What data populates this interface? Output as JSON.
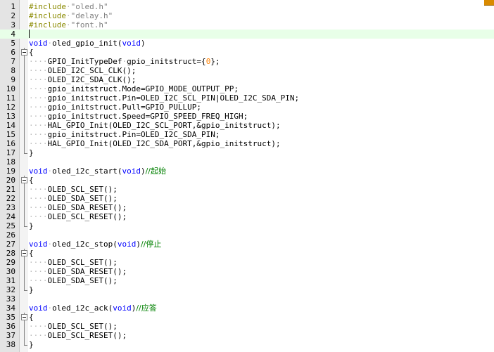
{
  "editor": {
    "colors": {
      "keyword": "#0000ff",
      "preprocessor": "#8a8a00",
      "string": "#808080",
      "number": "#ff8000",
      "comment": "#008000",
      "current_line": "#e8ffe8"
    },
    "lines": [
      {
        "n": "1",
        "fold": "",
        "tokens": [
          {
            "t": "pp",
            "v": "#include"
          },
          {
            "t": "indent",
            "v": "·"
          },
          {
            "t": "str",
            "v": "\"oled.h\""
          }
        ]
      },
      {
        "n": "2",
        "fold": "",
        "tokens": [
          {
            "t": "pp",
            "v": "#include"
          },
          {
            "t": "indent",
            "v": "·"
          },
          {
            "t": "str",
            "v": "\"delay.h\""
          }
        ]
      },
      {
        "n": "3",
        "fold": "",
        "tokens": [
          {
            "t": "pp",
            "v": "#include"
          },
          {
            "t": "indent",
            "v": "·"
          },
          {
            "t": "str",
            "v": "\"font.h\""
          }
        ]
      },
      {
        "n": "4",
        "fold": "",
        "current": true,
        "tokens": []
      },
      {
        "n": "5",
        "fold": "",
        "tokens": [
          {
            "t": "kw",
            "v": "void"
          },
          {
            "t": "indent",
            "v": "·"
          },
          {
            "t": "plain",
            "v": "oled_gpio_init("
          },
          {
            "t": "kw",
            "v": "void"
          },
          {
            "t": "plain",
            "v": ")"
          }
        ]
      },
      {
        "n": "6",
        "fold": "open",
        "tokens": [
          {
            "t": "plain",
            "v": "{"
          }
        ]
      },
      {
        "n": "7",
        "fold": "line",
        "tokens": [
          {
            "t": "indent",
            "v": "····"
          },
          {
            "t": "plain",
            "v": "GPIO_InitTypeDef"
          },
          {
            "t": "indent",
            "v": "·"
          },
          {
            "t": "plain",
            "v": "gpio_initstruct={"
          },
          {
            "t": "num",
            "v": "0"
          },
          {
            "t": "plain",
            "v": "};"
          }
        ]
      },
      {
        "n": "8",
        "fold": "line",
        "tokens": [
          {
            "t": "indent",
            "v": "····"
          },
          {
            "t": "plain",
            "v": "OLED_I2C_SCL_CLK();"
          }
        ]
      },
      {
        "n": "9",
        "fold": "line",
        "tokens": [
          {
            "t": "indent",
            "v": "····"
          },
          {
            "t": "plain",
            "v": "OLED_I2C_SDA_CLK();"
          }
        ]
      },
      {
        "n": "10",
        "fold": "line",
        "tokens": [
          {
            "t": "indent",
            "v": "····"
          },
          {
            "t": "plain",
            "v": "gpio_initstruct.Mode=GPIO_MODE_OUTPUT_PP;"
          }
        ]
      },
      {
        "n": "11",
        "fold": "line",
        "tokens": [
          {
            "t": "indent",
            "v": "····"
          },
          {
            "t": "plain",
            "v": "gpio_initstruct.Pin=OLED_I2C_SCL_PIN|OLED_I2C_SDA_PIN;"
          }
        ]
      },
      {
        "n": "12",
        "fold": "line",
        "tokens": [
          {
            "t": "indent",
            "v": "····"
          },
          {
            "t": "plain",
            "v": "gpio_initstruct.Pull=GPIO_PULLUP;"
          }
        ]
      },
      {
        "n": "13",
        "fold": "line",
        "tokens": [
          {
            "t": "indent",
            "v": "····"
          },
          {
            "t": "plain",
            "v": "gpio_initstruct.Speed=GPIO_SPEED_FREQ_HIGH;"
          }
        ]
      },
      {
        "n": "14",
        "fold": "line",
        "tokens": [
          {
            "t": "indent",
            "v": "····"
          },
          {
            "t": "plain",
            "v": "HAL_GPIO_Init(OLED_I2C_SCL_PORT,&gpio_initstruct);"
          }
        ]
      },
      {
        "n": "15",
        "fold": "line",
        "tokens": [
          {
            "t": "indent",
            "v": "····"
          },
          {
            "t": "plain",
            "v": "gpio_initstruct.Pin=OLED_I2C_SDA_PIN;"
          }
        ]
      },
      {
        "n": "16",
        "fold": "line",
        "tokens": [
          {
            "t": "indent",
            "v": "····"
          },
          {
            "t": "plain",
            "v": "HAL_GPIO_Init(OLED_I2C_SDA_PORT,&gpio_initstruct);"
          }
        ]
      },
      {
        "n": "17",
        "fold": "end",
        "tokens": [
          {
            "t": "plain",
            "v": "}"
          }
        ]
      },
      {
        "n": "18",
        "fold": "",
        "tokens": []
      },
      {
        "n": "19",
        "fold": "",
        "tokens": [
          {
            "t": "kw",
            "v": "void"
          },
          {
            "t": "indent",
            "v": "·"
          },
          {
            "t": "plain",
            "v": "oled_i2c_start("
          },
          {
            "t": "kw",
            "v": "void"
          },
          {
            "t": "plain",
            "v": ")"
          },
          {
            "t": "cm",
            "v": "//起始"
          }
        ]
      },
      {
        "n": "20",
        "fold": "open",
        "tokens": [
          {
            "t": "plain",
            "v": "{"
          }
        ]
      },
      {
        "n": "21",
        "fold": "line",
        "tokens": [
          {
            "t": "indent",
            "v": "····"
          },
          {
            "t": "plain",
            "v": "OLED_SCL_SET();"
          }
        ]
      },
      {
        "n": "22",
        "fold": "line",
        "tokens": [
          {
            "t": "indent",
            "v": "····"
          },
          {
            "t": "plain",
            "v": "OLED_SDA_SET();"
          }
        ]
      },
      {
        "n": "23",
        "fold": "line",
        "tokens": [
          {
            "t": "indent",
            "v": "····"
          },
          {
            "t": "plain",
            "v": "OLED_SDA_RESET();"
          }
        ]
      },
      {
        "n": "24",
        "fold": "line",
        "tokens": [
          {
            "t": "indent",
            "v": "····"
          },
          {
            "t": "plain",
            "v": "OLED_SCL_RESET();"
          }
        ]
      },
      {
        "n": "25",
        "fold": "end",
        "tokens": [
          {
            "t": "plain",
            "v": "}"
          }
        ]
      },
      {
        "n": "26",
        "fold": "",
        "tokens": []
      },
      {
        "n": "27",
        "fold": "",
        "tokens": [
          {
            "t": "kw",
            "v": "void"
          },
          {
            "t": "indent",
            "v": "·"
          },
          {
            "t": "plain",
            "v": "oled_i2c_stop("
          },
          {
            "t": "kw",
            "v": "void"
          },
          {
            "t": "plain",
            "v": ")"
          },
          {
            "t": "cm",
            "v": "//停止"
          }
        ]
      },
      {
        "n": "28",
        "fold": "open",
        "tokens": [
          {
            "t": "plain",
            "v": "{"
          }
        ]
      },
      {
        "n": "29",
        "fold": "line",
        "tokens": [
          {
            "t": "indent",
            "v": "····"
          },
          {
            "t": "plain",
            "v": "OLED_SCL_SET();"
          }
        ]
      },
      {
        "n": "30",
        "fold": "line",
        "tokens": [
          {
            "t": "indent",
            "v": "····"
          },
          {
            "t": "plain",
            "v": "OLED_SDA_RESET();"
          }
        ]
      },
      {
        "n": "31",
        "fold": "line",
        "tokens": [
          {
            "t": "indent",
            "v": "····"
          },
          {
            "t": "plain",
            "v": "OLED_SDA_SET();"
          }
        ]
      },
      {
        "n": "32",
        "fold": "end",
        "tokens": [
          {
            "t": "plain",
            "v": "}"
          }
        ]
      },
      {
        "n": "33",
        "fold": "",
        "tokens": []
      },
      {
        "n": "34",
        "fold": "",
        "tokens": [
          {
            "t": "kw",
            "v": "void"
          },
          {
            "t": "indent",
            "v": "·"
          },
          {
            "t": "plain",
            "v": "oled_i2c_ack("
          },
          {
            "t": "kw",
            "v": "void"
          },
          {
            "t": "plain",
            "v": ")"
          },
          {
            "t": "cm",
            "v": "//应答"
          }
        ]
      },
      {
        "n": "35",
        "fold": "open",
        "tokens": [
          {
            "t": "plain",
            "v": "{"
          }
        ]
      },
      {
        "n": "36",
        "fold": "line",
        "tokens": [
          {
            "t": "indent",
            "v": "····"
          },
          {
            "t": "plain",
            "v": "OLED_SCL_SET();"
          }
        ]
      },
      {
        "n": "37",
        "fold": "line",
        "tokens": [
          {
            "t": "indent",
            "v": "····"
          },
          {
            "t": "plain",
            "v": "OLED_SCL_RESET();"
          }
        ]
      },
      {
        "n": "38",
        "fold": "end",
        "tokens": [
          {
            "t": "plain",
            "v": "}"
          }
        ]
      }
    ]
  }
}
